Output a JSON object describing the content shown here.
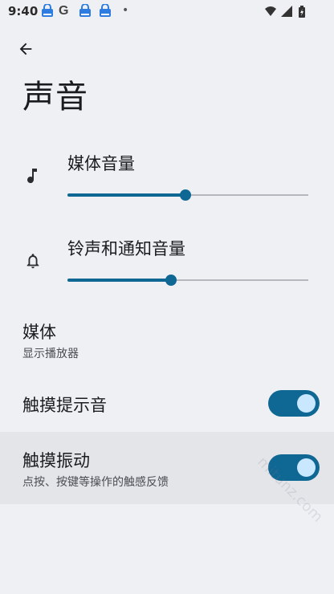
{
  "status_bar": {
    "time": "9:40",
    "notification_icons": [
      "app-notification-icon",
      "google-icon",
      "app-notification-icon",
      "app-notification-icon",
      "more-dot-icon"
    ],
    "right_icons": [
      "wifi-icon",
      "signal-icon",
      "battery-icon"
    ],
    "g_letter": "G",
    "dot": "•"
  },
  "header": {
    "title": "声音"
  },
  "volumes": [
    {
      "label": "媒体音量",
      "icon": "music-note-icon",
      "level": 0.49
    },
    {
      "label": "铃声和通知音量",
      "icon": "bell-icon",
      "level": 0.43
    }
  ],
  "media": {
    "title": "媒体",
    "subtitle": "显示播放器"
  },
  "touch_sound": {
    "title": "触摸提示音",
    "enabled": true
  },
  "touch_vibration": {
    "title": "触摸振动",
    "subtitle": "点按、按键等操作的触感反馈",
    "enabled": true
  },
  "watermark": "mitunz.com",
  "colors": {
    "accent": "#0f6793",
    "knob": "#c9e8ff",
    "background": "#eff0f4"
  }
}
